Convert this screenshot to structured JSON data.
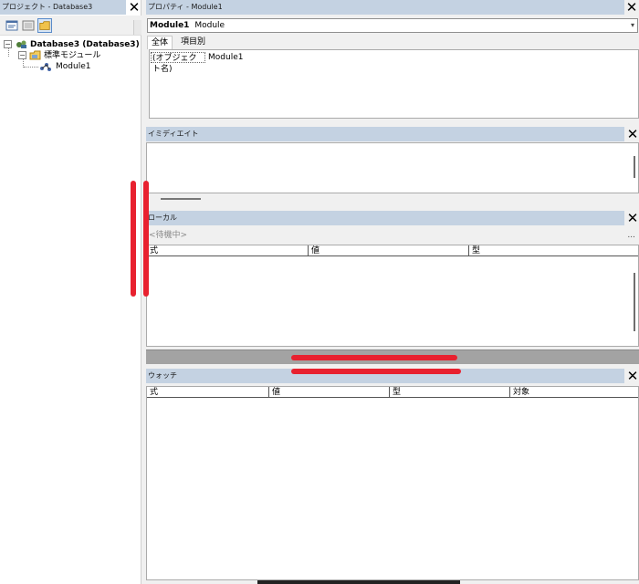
{
  "project_pane": {
    "title": "プロジェクト - Database3",
    "tree": {
      "root": "Database3 (Database3)",
      "folder": "標準モジュール",
      "module": "Module1"
    }
  },
  "properties_pane": {
    "title": "プロパティ - Module1",
    "object_selector": {
      "name": "Module1",
      "type": "Module"
    },
    "tabs": [
      "全体",
      "項目別"
    ],
    "rows": [
      {
        "name": "(オブジェクト名)",
        "value": "Module1"
      }
    ]
  },
  "immediate_pane": {
    "title": "イミディエイト"
  },
  "locals_pane": {
    "title": "ローカル",
    "context": "<待機中>",
    "context_more": "...",
    "columns": [
      "式",
      "値",
      "型"
    ]
  },
  "watch_pane": {
    "title": "ウォッチ",
    "columns": [
      "式",
      "値",
      "型",
      "対象"
    ]
  },
  "close_label": "✕",
  "colors": {
    "titlebar": "#c4d2e2",
    "annotation": "#e8212f",
    "splitter": "#a3a3a3"
  },
  "icons": [
    "project-view-code-icon",
    "project-view-object-icon",
    "toggle-folders-icon",
    "vba-project-icon",
    "module-folder-icon",
    "module-icon"
  ]
}
